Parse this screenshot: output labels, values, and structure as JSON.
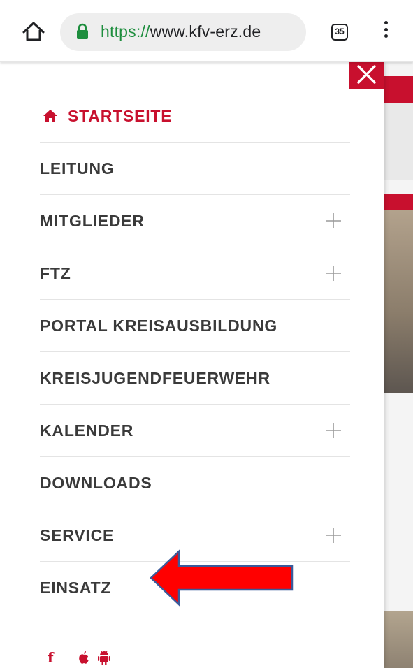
{
  "browser": {
    "url_scheme": "https://",
    "url_host": "www.kfv-erz.de",
    "tab_count": "35"
  },
  "menu": {
    "items": [
      {
        "label": "STARTSEITE",
        "active": true,
        "expandable": false
      },
      {
        "label": "LEITUNG",
        "active": false,
        "expandable": false
      },
      {
        "label": "MITGLIEDER",
        "active": false,
        "expandable": true
      },
      {
        "label": "FTZ",
        "active": false,
        "expandable": true
      },
      {
        "label": "PORTAL KREISAUSBILDUNG",
        "active": false,
        "expandable": false
      },
      {
        "label": "KREISJUGENDFEUERWEHR",
        "active": false,
        "expandable": false
      },
      {
        "label": "KALENDER",
        "active": false,
        "expandable": true
      },
      {
        "label": "DOWNLOADS",
        "active": false,
        "expandable": false
      },
      {
        "label": "SERVICE",
        "active": false,
        "expandable": true
      },
      {
        "label": "EINSATZ",
        "active": false,
        "expandable": false
      }
    ]
  },
  "social": {
    "facebook_glyph": "f"
  },
  "colors": {
    "accent": "#c8102e",
    "text": "#3a3a3a",
    "secure": "#1e8e3e",
    "arrow_fill": "#ff0000",
    "arrow_stroke": "#3b5a9a"
  },
  "icons": [
    "home-icon",
    "lock-icon",
    "tabs-icon",
    "overflow-menu-icon",
    "close-icon",
    "plus-icon",
    "facebook-icon",
    "apple-icon",
    "android-icon",
    "arrow-annotation"
  ]
}
